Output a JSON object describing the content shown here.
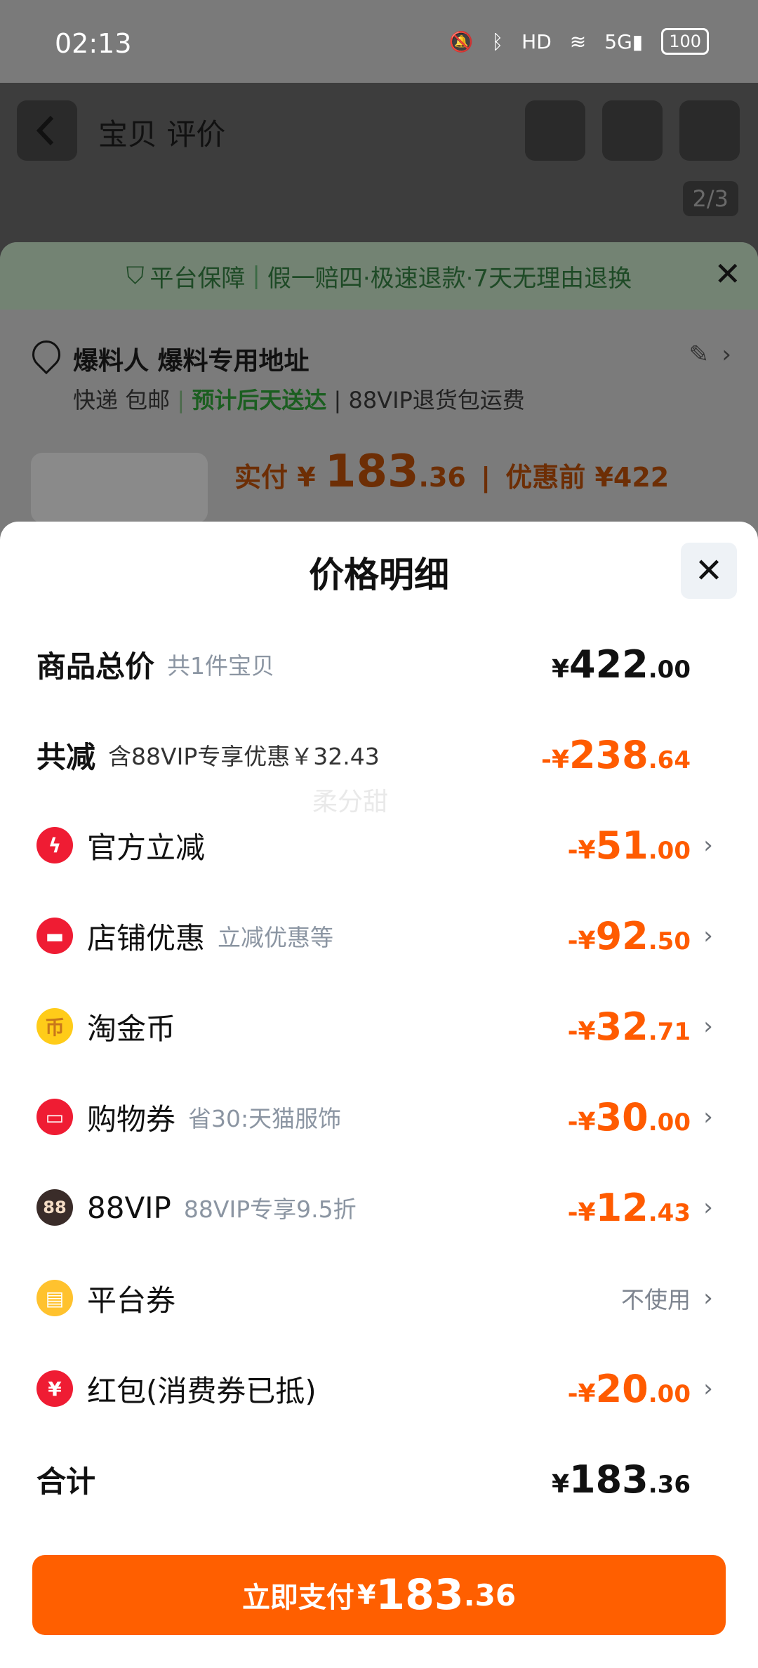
{
  "status": {
    "time": "02:13",
    "battery": "100",
    "icons": [
      "bell-off-icon",
      "bluetooth-icon",
      "hd-icon",
      "wifi-icon",
      "5g-signal-icon"
    ]
  },
  "background": {
    "page_title": "宝贝 评价",
    "page_counter": "2/3",
    "guarantee": {
      "main": "平台保障",
      "detail": "假一赔四·极速退款·7天无理由退换"
    },
    "address": {
      "title": "爆料人 爆料专用地址",
      "shipping": "快递 包邮",
      "eta": "预计后天送达",
      "vip": "88VIP退货包运费"
    },
    "paid": {
      "label": "实付",
      "amount_int": "183",
      "amount_dec": ".36",
      "sep": "|",
      "before_label": "优惠前",
      "before_amount": "¥422"
    }
  },
  "sheet": {
    "title": "价格明细",
    "watermark": "柔分甜",
    "total_price": {
      "label": "商品总价",
      "sub": "共1件宝贝",
      "yen": "¥",
      "int": "422",
      "dec": ".00"
    },
    "total_discount": {
      "label": "共减",
      "sub": "含88VIP专享优惠￥32.43",
      "yen": "-¥",
      "int": "238",
      "dec": ".64"
    },
    "items": [
      {
        "icon": "lightning-icon",
        "label": "官方立减",
        "sub": "",
        "yen": "-¥",
        "int": "51",
        "dec": ".00"
      },
      {
        "icon": "store-icon",
        "label": "店铺优惠",
        "sub": "立减优惠等",
        "yen": "-¥",
        "int": "92",
        "dec": ".50"
      },
      {
        "icon": "gold-coin-icon",
        "label": "淘金币",
        "sub": "",
        "yen": "-¥",
        "int": "32",
        "dec": ".71"
      },
      {
        "icon": "ticket-icon",
        "label": "购物券",
        "sub": "省30:天猫服饰",
        "yen": "-¥",
        "int": "30",
        "dec": ".00"
      },
      {
        "icon": "vip88-icon",
        "label": "88VIP",
        "sub": "88VIP专享9.5折",
        "yen": "-¥",
        "int": "12",
        "dec": ".43"
      },
      {
        "icon": "coupon-card-icon",
        "label": "平台券",
        "sub": "",
        "status": "不使用"
      },
      {
        "icon": "red-packet-icon",
        "label": "红包(消费券已抵)",
        "sub": "",
        "yen": "-¥",
        "int": "20",
        "dec": ".00"
      }
    ],
    "sum": {
      "label": "合计",
      "yen": "¥",
      "int": "183",
      "dec": ".36"
    },
    "pay_button": {
      "label": "立即支付",
      "yen": "¥",
      "int": "183",
      "dec": ".36"
    }
  }
}
